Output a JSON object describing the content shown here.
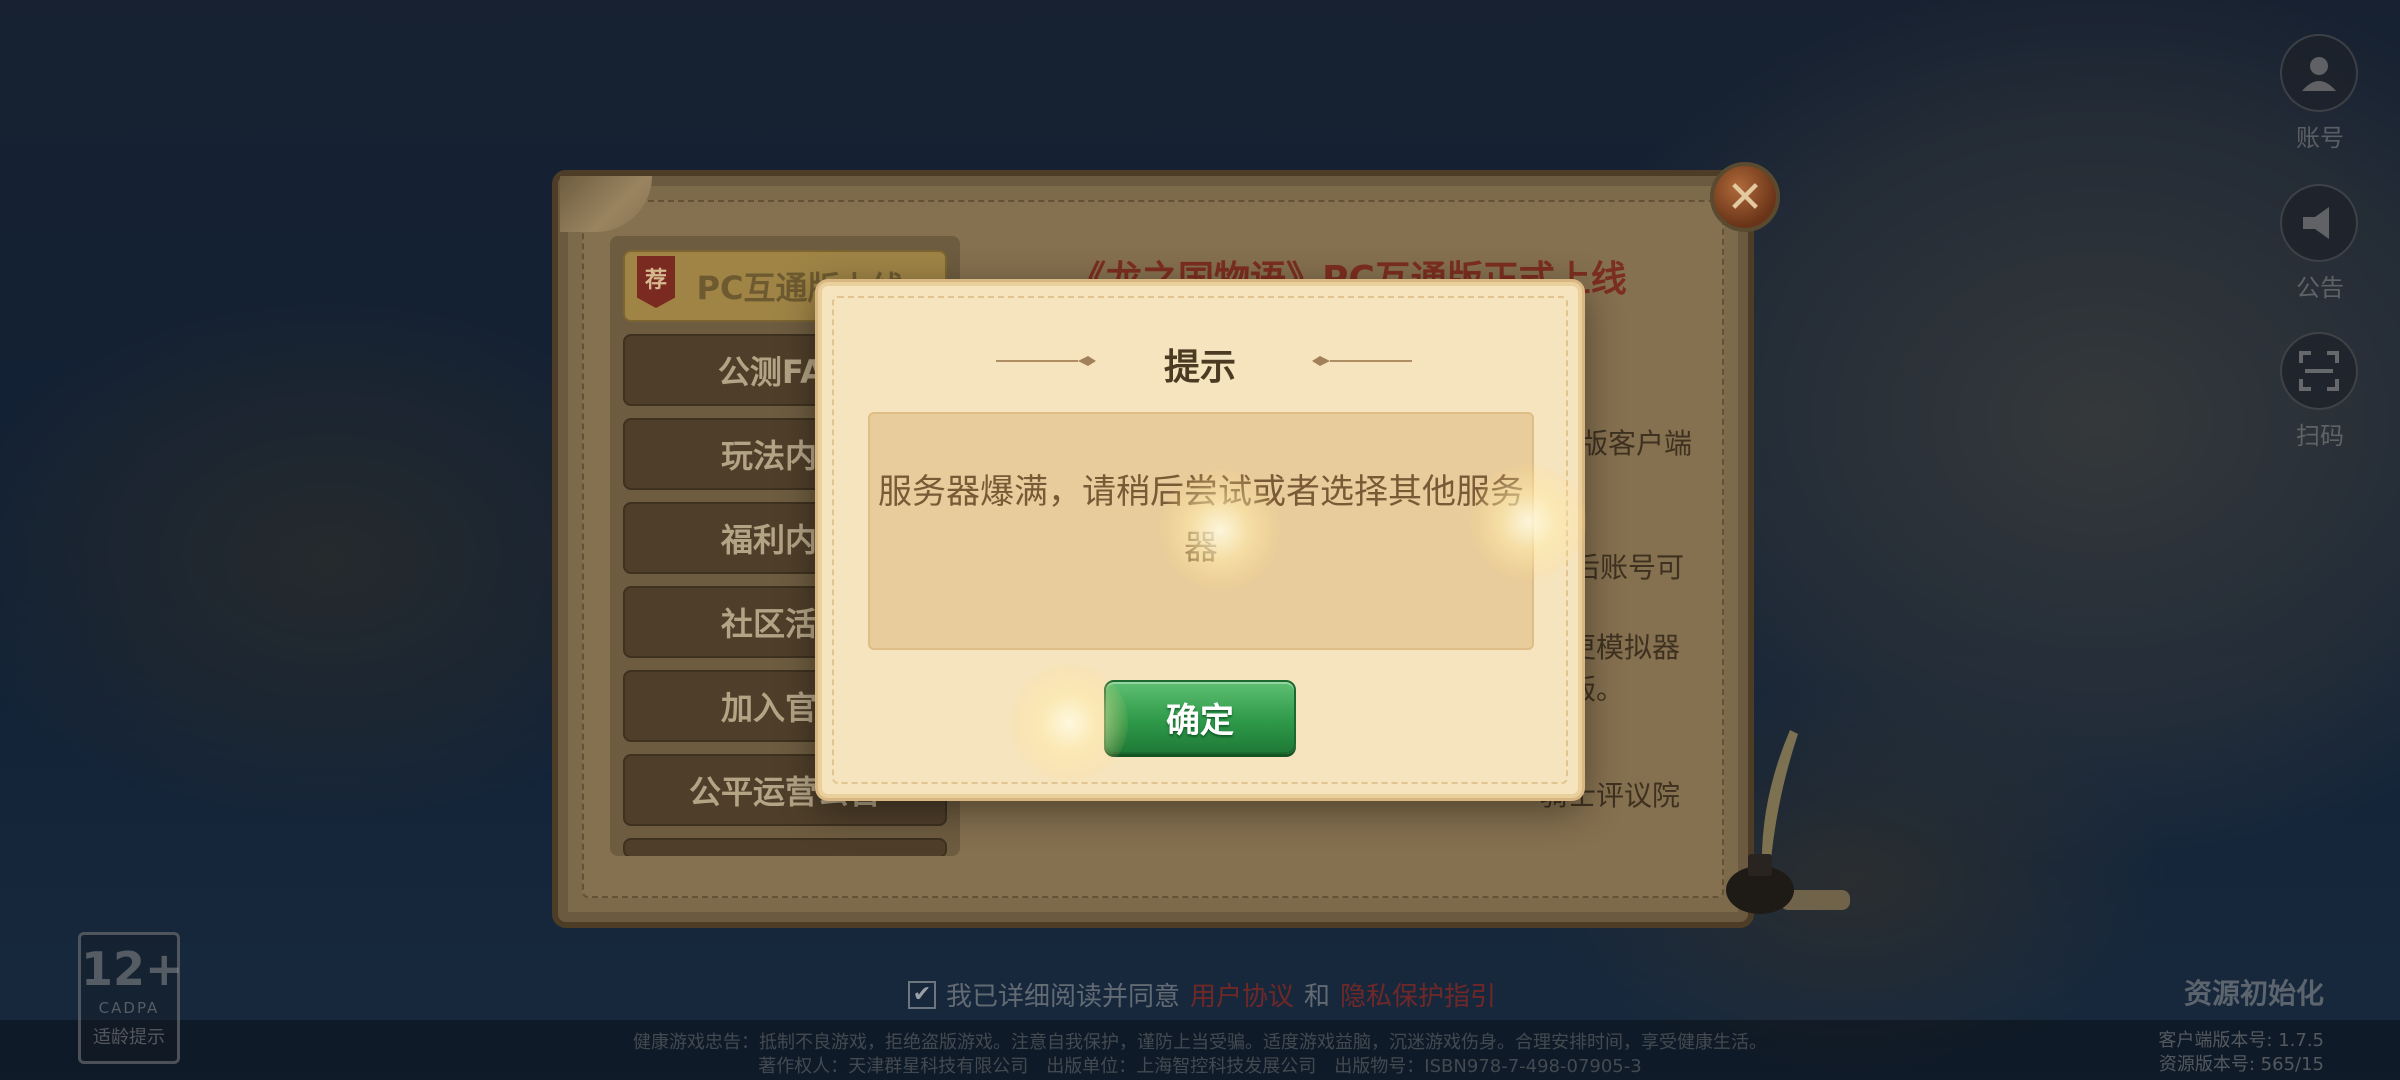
{
  "side_buttons": [
    {
      "label": "账号",
      "icon": "account-icon"
    },
    {
      "label": "公告",
      "icon": "announcement-icon"
    },
    {
      "label": "扫码",
      "icon": "scan-icon"
    }
  ],
  "announcement": {
    "close_icon": "close-icon",
    "title": "《龙之国物语》PC互通版正式上线",
    "menu": [
      {
        "label": "PC互通版上线",
        "badge": "荐",
        "active": true
      },
      {
        "label": "公测FAQ",
        "active": false
      },
      {
        "label": "玩法内容",
        "active": false
      },
      {
        "label": "福利内容",
        "active": false
      },
      {
        "label": "社区活动",
        "active": false
      },
      {
        "label": "加入官方",
        "active": false
      },
      {
        "label": "公平运营公告",
        "active": false
      }
    ],
    "body_fragments": {
      "line1": "版客户端",
      "line2": "后账号可",
      "line3": "更模拟器",
      "line4": "版。",
      "line5": "骑士评议院"
    }
  },
  "dialog": {
    "title": "提示",
    "message": "服务器爆满，请稍后尝试或者选择其他服务器",
    "confirm_label": "确定"
  },
  "footer": {
    "age_rating": {
      "age": "12+",
      "org": "CADPA",
      "tip": "适龄提示"
    },
    "agree": {
      "check_mark": "✔",
      "prefix": "我已详细阅读并同意",
      "link1": "用户协议",
      "conj": "和",
      "link2": "隐私保护指引"
    },
    "notice_line1": "健康游戏忠告：抵制不良游戏，拒绝盗版游戏。注意自我保护，谨防上当受骗。适度游戏益脑，沉迷游戏伤身。合理安排时间，享受健康生活。",
    "notice_line2": "著作权人：天津群星科技有限公司　出版单位：上海智控科技发展公司　出版物号：ISBN978-7-498-07905-3",
    "resource_status": "资源初始化",
    "client_version": "客户端版本号: 1.7.5",
    "resource_version": "资源版本号: 565/15"
  }
}
